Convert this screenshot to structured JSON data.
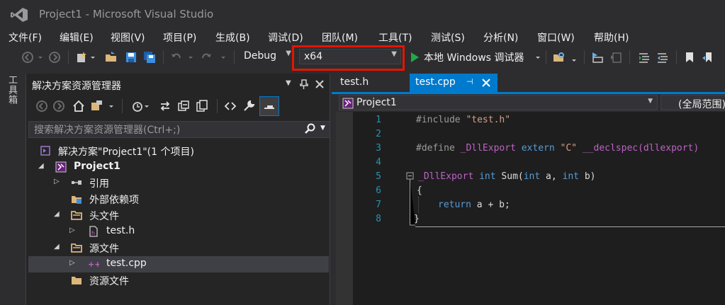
{
  "window": {
    "title": "Project1 - Microsoft Visual Studio"
  },
  "menu": [
    "文件(F)",
    "编辑(E)",
    "视图(V)",
    "项目(P)",
    "生成(B)",
    "调试(D)",
    "团队(M)",
    "工具(T)",
    "测试(S)",
    "分析(N)",
    "窗口(W)",
    "帮助(H)"
  ],
  "toolbar": {
    "config": "Debug",
    "platform": "x64",
    "run_label": "本地 Windows 调试器"
  },
  "toolbox": {
    "label": "工具箱"
  },
  "solution_explorer": {
    "title": "解决方案资源管理器",
    "search_placeholder": "搜索解决方案资源管理器(Ctrl+;)",
    "tree": [
      {
        "label": "解决方案\"Project1\"(1 个项目)",
        "icon": "solution-icon"
      },
      {
        "label": "Project1",
        "icon": "project-icon"
      },
      {
        "label": "引用",
        "icon": "references-icon"
      },
      {
        "label": "外部依赖项",
        "icon": "external-deps-icon"
      },
      {
        "label": "头文件",
        "icon": "folder-icon"
      },
      {
        "label": "test.h",
        "icon": "header-file-icon"
      },
      {
        "label": "源文件",
        "icon": "folder-icon"
      },
      {
        "label": "test.cpp",
        "icon": "cpp-file-icon"
      },
      {
        "label": "资源文件",
        "icon": "folder-icon"
      }
    ]
  },
  "editor": {
    "tabs": [
      {
        "label": "test.h",
        "active": false
      },
      {
        "label": "test.cpp",
        "active": true
      }
    ],
    "nav_project": "Project1",
    "nav_scope": "(全局范围)",
    "line_numbers": [
      "1",
      "2",
      "3",
      "4",
      "5",
      "6",
      "7",
      "8"
    ],
    "code": {
      "l1_directive": "#include",
      "l1_string": "\"test.h\"",
      "l3_directive": "#define",
      "l3_macro": "_DllExport",
      "l3_kw": "extern",
      "l3_string": "\"C\"",
      "l3_rest": "__declspec(dllexport)",
      "l5_macro": "_DllExport",
      "l5_kw_int": "int",
      "l5_fn": "Sum(",
      "l5_kw_int2": "int",
      "l5_a": "a,",
      "l5_kw_int3": "int",
      "l5_b": "b)",
      "l6_brace": "{",
      "l7_kw": "return",
      "l7_expr": "a + b;",
      "l8_brace": "}"
    }
  },
  "colors": {
    "highlight": "#e51400",
    "accent": "#007acc"
  }
}
